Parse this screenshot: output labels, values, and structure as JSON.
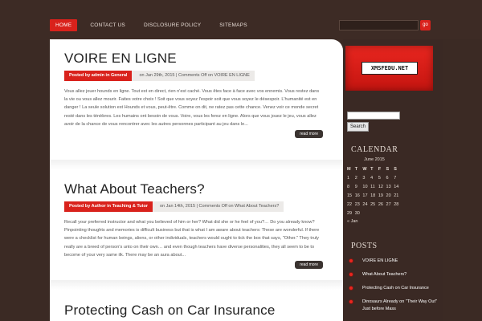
{
  "nav": {
    "items": [
      "HOME",
      "CONTACT US",
      "DISCLOSURE POLICY",
      "SITEMAPS"
    ]
  },
  "search_top": {
    "button": "go",
    "value": ""
  },
  "posts": [
    {
      "title": "VOIRE EN LIGNE",
      "byline": "Posted by admin in General",
      "info": "on Jan 29th, 2015 | Comments Off on VOIRE EN LIGNE",
      "excerpt": "Vous allez jouer hounds en ligne. Tout est en direct, rien n'est caché. Vous êtes face à face avec vos ennemis. Vous restez dans la vie ou vous allez mourir. Faites votre choix ! Soit que vous soyez l'espoir soit que vous soyez le désespoir. L'humanité est en danger ! La seule solution est Hounds et vous, peut-être. Comme on dit, ne ratez pas cette chance. Venez voir ce monde secret resté dans les ténèbres. Les humains ont besoin de vous. Voire, vous les ferez en ligne. Alors que vous jouez le jeu, vous allez avoir de la chance de vous rencontrer avec les autres personnes participant au jeu dans le...",
      "more": "read more"
    },
    {
      "title": "What About Teachers?",
      "byline": "Posted by Author in Teaching & Tutor",
      "info": "on Jan 14th, 2015 | Comments Off on What About Teachers?",
      "excerpt": "  Recall your preferred instructor and what you believed of him or her? What did she or he feel of you?… Do you already know? Pinpointing thoughts and memories is difficult business but that is what I am aware about teachers: These are wonderful. If there were a checklist for human beings, aliens, or other individuals, teachers would ought to tick the box that says, \"Other.\" They truly really are a breed of person's unto on their own… and even though teachers have diverse personalities, they all seem to be to become of your very same ilk. There may be an aura about...",
      "more": "read more"
    },
    {
      "title": "Protecting Cash on Car Insurance"
    }
  ],
  "sidebar": {
    "logo_text": "XMSFEDU.NET",
    "search_button": "Search",
    "calendar_title": "CALENDAR",
    "calendar": {
      "caption": "June 2015",
      "days": [
        "M",
        "T",
        "W",
        "T",
        "F",
        "S",
        "S"
      ],
      "weeks": [
        [
          "1",
          "2",
          "3",
          "4",
          "5",
          "6",
          "7"
        ],
        [
          "8",
          "9",
          "10",
          "11",
          "12",
          "13",
          "14"
        ],
        [
          "15",
          "16",
          "17",
          "18",
          "19",
          "20",
          "21"
        ],
        [
          "22",
          "23",
          "24",
          "25",
          "26",
          "27",
          "28"
        ],
        [
          "29",
          "30",
          "",
          "",
          "",
          "",
          ""
        ]
      ],
      "prev": "« Jan"
    },
    "posts_title": "POSTS",
    "recent_posts": [
      "VOIRE EN LIGNE",
      "What About Teachers?",
      "Protecting Cash on Car Insurance",
      "Dinosaurs Already on \"Their Way Out\" Just before Mass"
    ]
  },
  "colors": {
    "accent": "#d9221c",
    "background": "#3b2a24"
  }
}
